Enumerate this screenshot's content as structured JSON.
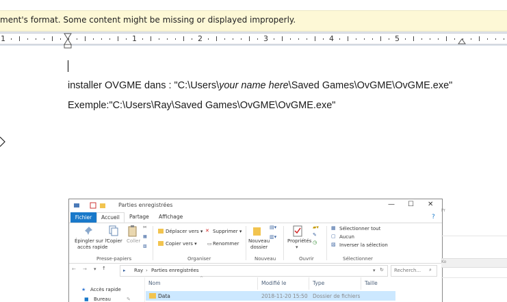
{
  "infobar": {
    "text": "ment's format. Some content might be missing or displayed improperly."
  },
  "ruler": {
    "numbers": [
      "1",
      "1",
      "2",
      "3",
      "4",
      "5"
    ]
  },
  "document": {
    "line1_prefix": "installer OVGME  dans : \"C:\\Users\\",
    "line1_italic": "your name here",
    "line1_suffix": "\\Saved Games\\OvGME\\OvGME.exe\"",
    "line2": "Exemple:\"C:\\Users\\Ray\\Saved Games\\OvGME\\OvGME.exe\""
  },
  "explorer": {
    "window_title": "Parties enregistrées",
    "tabs": {
      "file": "Fichier",
      "home": "Accueil",
      "share": "Partage",
      "view": "Affichage"
    },
    "ribbon": {
      "pin_label": "Épingler sur l' accès rapide",
      "pin_line1": "Épingler sur l'",
      "pin_line2": "accès rapide",
      "copy": "Copier",
      "paste": "Coller",
      "move_to": "Déplacer vers",
      "copy_to": "Copier vers",
      "delete": "Supprimer",
      "rename": "Renommer",
      "new_folder_line1": "Nouveau",
      "new_folder_line2": "dossier",
      "properties": "Propriétés",
      "select_all": "Sélectionner tout",
      "select_none": "Aucun",
      "invert_selection": "Inverser la sélection",
      "groups": {
        "clipboard": "Presse-papiers",
        "organize": "Organiser",
        "new": "Nouveau",
        "open": "Ouvrir",
        "select": "Sélectionner"
      }
    },
    "address": {
      "crumb1": "Ray",
      "crumb2": "Parties enregistrées",
      "search_placeholder": "Recherch..."
    },
    "nav": {
      "quick_access": "Accès rapide",
      "desktop": "Bureau"
    },
    "columns": {
      "name": "Nom",
      "modified": "Modifié le",
      "type": "Type",
      "size": "Taille"
    },
    "rows": [
      {
        "name": "Data",
        "modified": "2018-11-20 15:50",
        "type": "Dossier de fichiers"
      }
    ]
  }
}
